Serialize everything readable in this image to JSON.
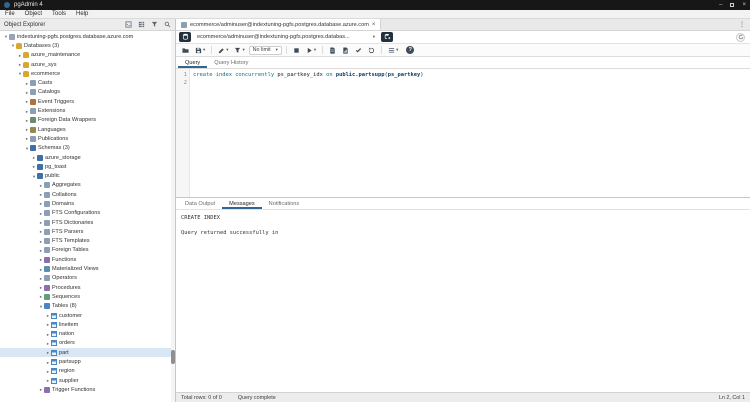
{
  "titlebar": {
    "title": "pgAdmin 4"
  },
  "menubar": {
    "items": [
      "File",
      "Object",
      "Tools",
      "Help"
    ]
  },
  "sidebar": {
    "header": "Object Explorer",
    "browser_toolbar_icons": [
      "query-tool-icon",
      "view-data-icon",
      "filtered-rows-icon",
      "search-objects-icon"
    ],
    "tree": [
      {
        "label": "indextuning-pgfs.postgres.database.azure.com",
        "level": 0,
        "arrow": "expanded",
        "icon": "server-icon"
      },
      {
        "label": "Databases (3)",
        "level": 1,
        "arrow": "expanded",
        "icon": "databases-icon"
      },
      {
        "label": "azure_maintenance",
        "level": 2,
        "arrow": "collapsed",
        "icon": "database-icon"
      },
      {
        "label": "azure_sys",
        "level": 2,
        "arrow": "collapsed",
        "icon": "database-icon"
      },
      {
        "label": "ecommerce",
        "level": 2,
        "arrow": "expanded",
        "icon": "database-icon"
      },
      {
        "label": "Casts",
        "level": 3,
        "arrow": "collapsed",
        "icon": "casts-icon"
      },
      {
        "label": "Catalogs",
        "level": 3,
        "arrow": "collapsed",
        "icon": "catalogs-icon"
      },
      {
        "label": "Event Triggers",
        "level": 3,
        "arrow": "collapsed",
        "icon": "event-triggers-icon"
      },
      {
        "label": "Extensions",
        "level": 3,
        "arrow": "collapsed",
        "icon": "extensions-icon"
      },
      {
        "label": "Foreign Data Wrappers",
        "level": 3,
        "arrow": "collapsed",
        "icon": "fdw-icon"
      },
      {
        "label": "Languages",
        "level": 3,
        "arrow": "collapsed",
        "icon": "languages-icon"
      },
      {
        "label": "Publications",
        "level": 3,
        "arrow": "collapsed",
        "icon": "publications-icon"
      },
      {
        "label": "Schemas (3)",
        "level": 3,
        "arrow": "expanded",
        "icon": "schemas-icon"
      },
      {
        "label": "azure_storage",
        "level": 4,
        "arrow": "collapsed",
        "icon": "schema-icon"
      },
      {
        "label": "pg_toast",
        "level": 4,
        "arrow": "collapsed",
        "icon": "schema-icon"
      },
      {
        "label": "public",
        "level": 4,
        "arrow": "expanded",
        "icon": "schema-icon"
      },
      {
        "label": "Aggregates",
        "level": 5,
        "arrow": "collapsed",
        "icon": "aggregates-icon"
      },
      {
        "label": "Collations",
        "level": 5,
        "arrow": "collapsed",
        "icon": "collations-icon"
      },
      {
        "label": "Domains",
        "level": 5,
        "arrow": "collapsed",
        "icon": "domains-icon"
      },
      {
        "label": "FTS Configurations",
        "level": 5,
        "arrow": "collapsed",
        "icon": "fts-configurations-icon"
      },
      {
        "label": "FTS Dictionaries",
        "level": 5,
        "arrow": "collapsed",
        "icon": "fts-dictionaries-icon"
      },
      {
        "label": "FTS Parsers",
        "level": 5,
        "arrow": "collapsed",
        "icon": "fts-parsers-icon"
      },
      {
        "label": "FTS Templates",
        "level": 5,
        "arrow": "collapsed",
        "icon": "fts-templates-icon"
      },
      {
        "label": "Foreign Tables",
        "level": 5,
        "arrow": "collapsed",
        "icon": "foreign-tables-icon"
      },
      {
        "label": "Functions",
        "level": 5,
        "arrow": "collapsed",
        "icon": "functions-icon"
      },
      {
        "label": "Materialized Views",
        "level": 5,
        "arrow": "collapsed",
        "icon": "materialized-views-icon"
      },
      {
        "label": "Operators",
        "level": 5,
        "arrow": "collapsed",
        "icon": "operators-icon"
      },
      {
        "label": "Procedures",
        "level": 5,
        "arrow": "collapsed",
        "icon": "procedures-icon"
      },
      {
        "label": "Sequences",
        "level": 5,
        "arrow": "collapsed",
        "icon": "sequences-icon"
      },
      {
        "label": "Tables (8)",
        "level": 5,
        "arrow": "expanded",
        "icon": "tables-icon"
      },
      {
        "label": "customer",
        "level": 6,
        "arrow": "collapsed",
        "icon": "table-icon"
      },
      {
        "label": "lineitem",
        "level": 6,
        "arrow": "collapsed",
        "icon": "table-icon"
      },
      {
        "label": "nation",
        "level": 6,
        "arrow": "collapsed",
        "icon": "table-icon"
      },
      {
        "label": "orders",
        "level": 6,
        "arrow": "collapsed",
        "icon": "table-icon"
      },
      {
        "label": "part",
        "level": 6,
        "arrow": "collapsed",
        "icon": "table-icon",
        "selected": true
      },
      {
        "label": "partsupp",
        "level": 6,
        "arrow": "collapsed",
        "icon": "table-icon"
      },
      {
        "label": "region",
        "level": 6,
        "arrow": "collapsed",
        "icon": "table-icon"
      },
      {
        "label": "supplier",
        "level": 6,
        "arrow": "collapsed",
        "icon": "table-icon"
      },
      {
        "label": "Trigger Functions",
        "level": 5,
        "arrow": "collapsed",
        "icon": "trigger-functions-icon"
      }
    ]
  },
  "main": {
    "tab": {
      "title": "ecommerce/adminuser@indextuning-pgfs.postgres.database.azure.com",
      "close": "×"
    },
    "connection": {
      "value": "ecommerce/adminuser@indextuning-pgfs.postgres.databas..."
    },
    "toolbar": {
      "limit_value": "No limit"
    },
    "query_tabs": {
      "query": "Query",
      "history": "Query History"
    },
    "editor": {
      "line_numbers": [
        "1",
        "2"
      ],
      "sql_segments": [
        {
          "text": "create index concurrently ",
          "cls": "kw"
        },
        {
          "text": "ps_partkey_idx ",
          "cls": "id"
        },
        {
          "text": "on ",
          "cls": "kw"
        },
        {
          "text": "public.partsupp",
          "cls": "id2"
        },
        {
          "text": "(",
          "cls": "id"
        },
        {
          "text": "ps_partkey",
          "cls": "id2"
        },
        {
          "text": ")",
          "cls": "id"
        }
      ]
    },
    "output_tabs": {
      "data_output": "Data Output",
      "messages": "Messages",
      "notifications": "Notifications"
    },
    "messages": [
      "CREATE INDEX",
      "Query returned successfully in"
    ],
    "statusbar": {
      "total_rows": "Total rows: 0 of 0",
      "status": "Query complete",
      "cursor": "Ln 2, Col 1"
    }
  },
  "colors": {
    "accent": "#326690",
    "selection": "#d9e7f4",
    "titlebar": "#171717",
    "keyword": "#0b7285",
    "identifier_bold": "#0d3b66"
  }
}
